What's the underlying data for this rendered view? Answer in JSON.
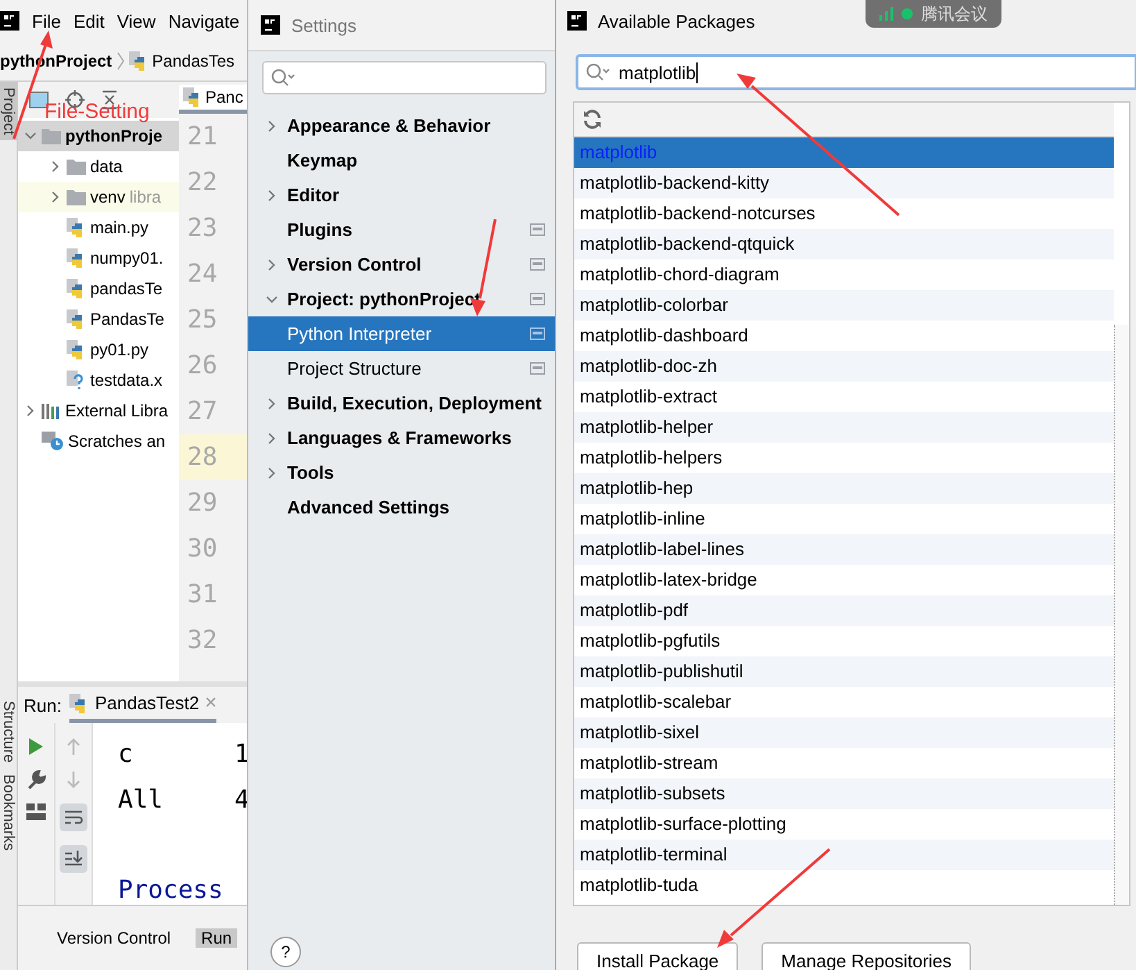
{
  "ide": {
    "menu": [
      "File",
      "Edit",
      "View",
      "Navigate"
    ],
    "breadcrumbs": [
      "pythonProject",
      "PandasTes"
    ],
    "side_tabs": [
      {
        "label": "Project",
        "selected": true
      },
      {
        "label": "Structure",
        "selected": false
      },
      {
        "label": "Bookmarks",
        "selected": false
      }
    ],
    "tree": [
      {
        "label": "pythonProje",
        "kind": "root",
        "expanded": true,
        "selected": true,
        "children": [
          {
            "label": "data",
            "kind": "folder",
            "expanded": false,
            "selected": false
          },
          {
            "label": "venv",
            "note": "libra",
            "kind": "folder",
            "expanded": false,
            "selected": false
          },
          {
            "label": "main.py",
            "kind": "python",
            "selected": false
          },
          {
            "label": "numpy01.",
            "kind": "python",
            "selected": false
          },
          {
            "label": "pandasTe",
            "kind": "python",
            "selected": false
          },
          {
            "label": "PandasTe",
            "kind": "python",
            "selected": false
          },
          {
            "label": "py01.py",
            "kind": "python",
            "selected": false
          },
          {
            "label": "testdata.x",
            "kind": "unknown",
            "selected": false
          }
        ]
      },
      {
        "label": "External Libra",
        "kind": "library",
        "expanded": false,
        "selected": false
      },
      {
        "label": "Scratches an",
        "kind": "scratches",
        "selected": false
      }
    ],
    "editor_tab": "Panc",
    "line_numbers": [
      {
        "number": "21",
        "selected": false
      },
      {
        "number": "22",
        "selected": false
      },
      {
        "number": "23",
        "selected": false
      },
      {
        "number": "24",
        "selected": false
      },
      {
        "number": "25",
        "selected": false
      },
      {
        "number": "26",
        "selected": false
      },
      {
        "number": "27",
        "selected": false
      },
      {
        "number": "28",
        "selected": true
      },
      {
        "number": "29",
        "selected": false
      },
      {
        "number": "30",
        "selected": false
      },
      {
        "number": "31",
        "selected": false
      },
      {
        "number": "32",
        "selected": false
      }
    ],
    "run": {
      "label": "Run:",
      "tab": "PandasTest2",
      "close": "×",
      "console": [
        {
          "kind": "row",
          "text": "c",
          "value": "1"
        },
        {
          "kind": "row",
          "text": "All",
          "value": "4"
        },
        {
          "kind": "status",
          "text": "Process"
        }
      ]
    },
    "bottom_tabs": [
      {
        "label": "Version Control",
        "selected": false
      },
      {
        "label": "Run",
        "selected": true
      }
    ]
  },
  "annotation": {
    "text": "File-Setting"
  },
  "settings": {
    "title": "Settings",
    "items": [
      {
        "label": "Appearance & Behavior",
        "expanded": false,
        "selected": false
      },
      {
        "label": "Keymap",
        "selected": false
      },
      {
        "label": "Editor",
        "expanded": false,
        "selected": false
      },
      {
        "label": "Plugins",
        "selected": false,
        "project_scope": true
      },
      {
        "label": "Version Control",
        "expanded": false,
        "selected": false,
        "project_scope": true
      },
      {
        "label": "Project: pythonProject",
        "expanded": true,
        "selected": false,
        "project_scope": true,
        "children": [
          {
            "label": "Python Interpreter",
            "selected": true,
            "project_scope": true
          },
          {
            "label": "Project Structure",
            "selected": false,
            "project_scope": true
          }
        ]
      },
      {
        "label": "Build, Execution, Deployment",
        "expanded": false,
        "selected": false
      },
      {
        "label": "Languages & Frameworks",
        "expanded": false,
        "selected": false
      },
      {
        "label": "Tools",
        "expanded": false,
        "selected": false
      },
      {
        "label": "Advanced Settings",
        "selected": false
      }
    ],
    "help": "?"
  },
  "packages": {
    "title": "Available Packages",
    "search": {
      "value": "matplotlib"
    },
    "items": [
      {
        "name": "matplotlib",
        "selected": true
      },
      {
        "name": "matplotlib-backend-kitty",
        "selected": false
      },
      {
        "name": "matplotlib-backend-notcurses",
        "selected": false
      },
      {
        "name": "matplotlib-backend-qtquick",
        "selected": false
      },
      {
        "name": "matplotlib-chord-diagram",
        "selected": false
      },
      {
        "name": "matplotlib-colorbar",
        "selected": false
      },
      {
        "name": "matplotlib-dashboard",
        "selected": false
      },
      {
        "name": "matplotlib-doc-zh",
        "selected": false
      },
      {
        "name": "matplotlib-extract",
        "selected": false
      },
      {
        "name": "matplotlib-helper",
        "selected": false
      },
      {
        "name": "matplotlib-helpers",
        "selected": false
      },
      {
        "name": "matplotlib-hep",
        "selected": false
      },
      {
        "name": "matplotlib-inline",
        "selected": false
      },
      {
        "name": "matplotlib-label-lines",
        "selected": false
      },
      {
        "name": "matplotlib-latex-bridge",
        "selected": false
      },
      {
        "name": "matplotlib-pdf",
        "selected": false
      },
      {
        "name": "matplotlib-pgfutils",
        "selected": false
      },
      {
        "name": "matplotlib-publishutil",
        "selected": false
      },
      {
        "name": "matplotlib-scalebar",
        "selected": false
      },
      {
        "name": "matplotlib-sixel",
        "selected": false
      },
      {
        "name": "matplotlib-stream",
        "selected": false
      },
      {
        "name": "matplotlib-subsets",
        "selected": false
      },
      {
        "name": "matplotlib-surface-plotting",
        "selected": false
      },
      {
        "name": "matplotlib-terminal",
        "selected": false
      },
      {
        "name": "matplotlib-tuda",
        "selected": false
      }
    ],
    "buttons": [
      "Install Package",
      "Manage Repositories"
    ]
  },
  "meeting": {
    "app": "腾讯会议"
  }
}
